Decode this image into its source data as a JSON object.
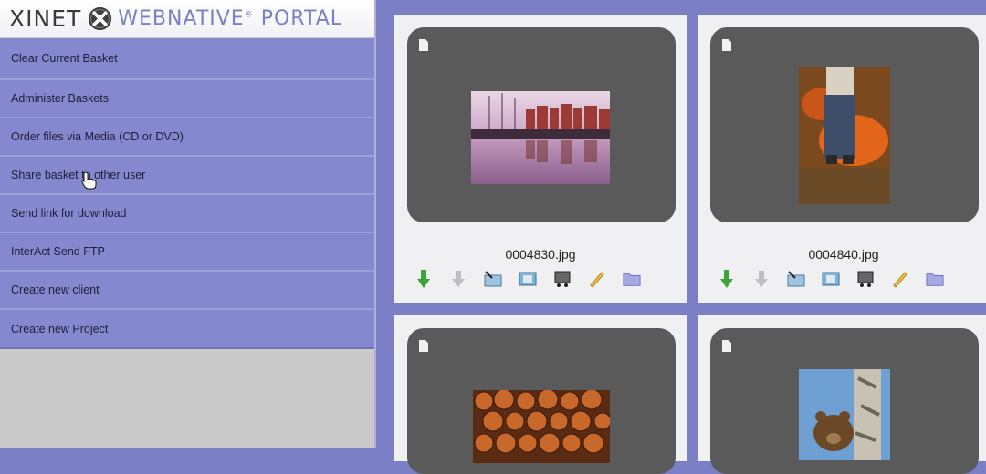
{
  "logo": {
    "brand": "XINET",
    "product": "WEBNATIVE",
    "suffix": "PORTAL",
    "reg": "®"
  },
  "menu": [
    "Clear Current Basket",
    "Administer Baskets",
    "Order files via Media (CD or DVD)",
    "Share basket to other user",
    "Send link for download",
    "InterAct Send FTP",
    "Create new client",
    "Create new Project"
  ],
  "files": [
    {
      "name": "0004830.jpg"
    },
    {
      "name": "0004840.jpg"
    },
    {
      "name": ""
    },
    {
      "name": ""
    }
  ],
  "colors": {
    "accent": "#7b7fc6",
    "menu_bg": "#8588ce",
    "tile_bg": "#5a5a5a"
  },
  "icons": [
    "download-arrow-icon",
    "download-gray-icon",
    "folder-move-icon",
    "preview-icon",
    "cart-icon",
    "edit-pencil-icon",
    "folder-icon"
  ]
}
